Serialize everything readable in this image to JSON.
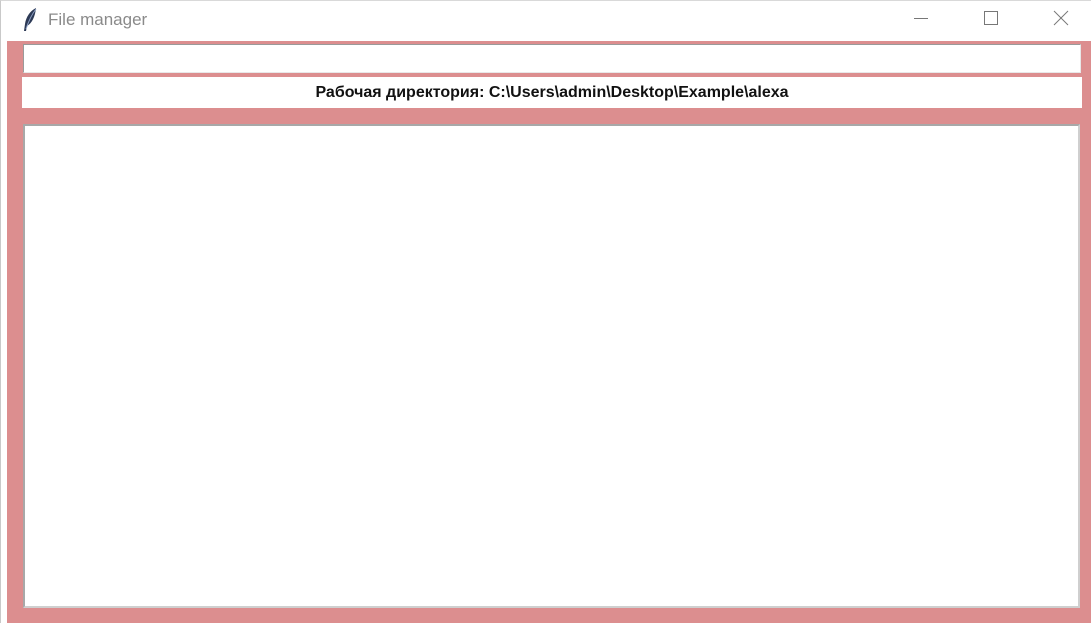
{
  "window": {
    "title": "File manager",
    "app_icon": "feather-icon",
    "controls": {
      "minimize_icon": "minimize-icon",
      "maximize_icon": "maximize-icon",
      "close_icon": "close-icon"
    }
  },
  "path_entry": {
    "value": ""
  },
  "workdir": {
    "text": "Рабочая директория: C:\\Users\\admin\\Desktop\\Example\\alexa"
  },
  "file_list": {
    "items": []
  },
  "colors": {
    "background": "#dc8e8f",
    "panel": "#ffffff",
    "title_text": "#8a8a8a"
  }
}
